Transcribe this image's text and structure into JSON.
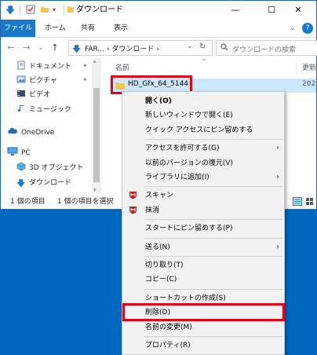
{
  "window": {
    "title": "ダウンロード",
    "minimize": "—",
    "maximize": "☐",
    "close": "✕"
  },
  "ribbon": {
    "tabs": [
      "ファイル",
      "ホーム",
      "共有",
      "表示"
    ],
    "help": "?"
  },
  "nav": {
    "back": "←",
    "forward": "→",
    "recent": "⌄",
    "up": "↑",
    "address": "FAR... › ダウンロード ›",
    "dropdown": "⌄",
    "refresh": "↻",
    "search_placeholder": "ダウンロードの検索"
  },
  "sidebar": {
    "items": [
      {
        "label": "ドキュメント",
        "pinned": true
      },
      {
        "label": "ピクチャ",
        "pinned": true
      },
      {
        "label": "ビデオ",
        "pinned": false
      },
      {
        "label": "ミュージック",
        "pinned": false
      },
      {
        "label": "OneDrive",
        "pinned": false
      },
      {
        "label": "PC",
        "pinned": false
      },
      {
        "label": "3D オブジェクト",
        "pinned": false
      },
      {
        "label": "ダウンロード",
        "pinned": false
      }
    ],
    "pin_glyph": "📌"
  },
  "columns": {
    "name": "名前",
    "date": "更新"
  },
  "files": [
    {
      "name": "HD_Gfx_64_5144",
      "date": "202"
    }
  ],
  "status": {
    "count": "1 個の項目",
    "selected": "1 個の項目を選択"
  },
  "context_menu": {
    "items": [
      {
        "label": "開く(O)",
        "bold": true,
        "arrow": false
      },
      {
        "label": "新しいウィンドウで開く(E)",
        "arrow": false
      },
      {
        "label": "クイック アクセスにピン留めする",
        "arrow": false
      },
      {
        "sep": true
      },
      {
        "label": "アクセスを許可する(G)",
        "arrow": true
      },
      {
        "label": "以前のバージョンの復元(V)",
        "arrow": false
      },
      {
        "label": "ライブラリに追加(I)",
        "arrow": true
      },
      {
        "sep": true
      },
      {
        "label": "スキャン",
        "arrow": false,
        "icon": "mcafee"
      },
      {
        "label": "抹消",
        "arrow": false,
        "icon": "mcafee"
      },
      {
        "sep": true
      },
      {
        "label": "スタートにピン留めする(P)",
        "arrow": false
      },
      {
        "sep": true
      },
      {
        "label": "送る(N)",
        "arrow": true
      },
      {
        "sep": true
      },
      {
        "label": "切り取り(T)",
        "arrow": false
      },
      {
        "label": "コピー(C)",
        "arrow": false
      },
      {
        "sep": true
      },
      {
        "label": "ショートカットの作成(S)",
        "arrow": false
      },
      {
        "label": "削除(D)",
        "arrow": false,
        "highlight": true
      },
      {
        "label": "名前の変更(M)",
        "arrow": false
      },
      {
        "sep": true
      },
      {
        "label": "プロパティ(R)",
        "arrow": false
      }
    ],
    "arrow_glyph": "›"
  },
  "colors": {
    "accent": "#1979ca",
    "desktop": "#0067c0",
    "highlight_border": "#e60012",
    "folder": "#f5c54b",
    "mcafee": "#c01818"
  }
}
